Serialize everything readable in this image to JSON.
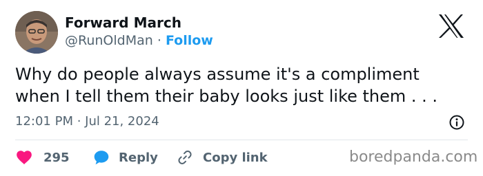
{
  "author": {
    "name": "Forward March",
    "handle": "@RunOldMan",
    "separator": "·",
    "follow_label": "Follow"
  },
  "tweet": {
    "lines": [
      "Why do people always assume it's a compliment",
      "when I tell them their baby looks just like them . . ."
    ],
    "timestamp": "12:01 PM · Jul 21, 2024"
  },
  "actions": {
    "like_count": "295",
    "reply_label": "Reply",
    "copy_label": "Copy link"
  },
  "icons": {
    "logo": "x-logo-icon",
    "info": "info-icon",
    "like": "heart-icon",
    "reply": "speech-bubble-icon",
    "copy": "link-icon"
  },
  "colors": {
    "accent": "#1d9bf0",
    "like": "#f91880",
    "text": "#0f1419",
    "muted": "#536471"
  },
  "watermark": "boredpanda.com"
}
